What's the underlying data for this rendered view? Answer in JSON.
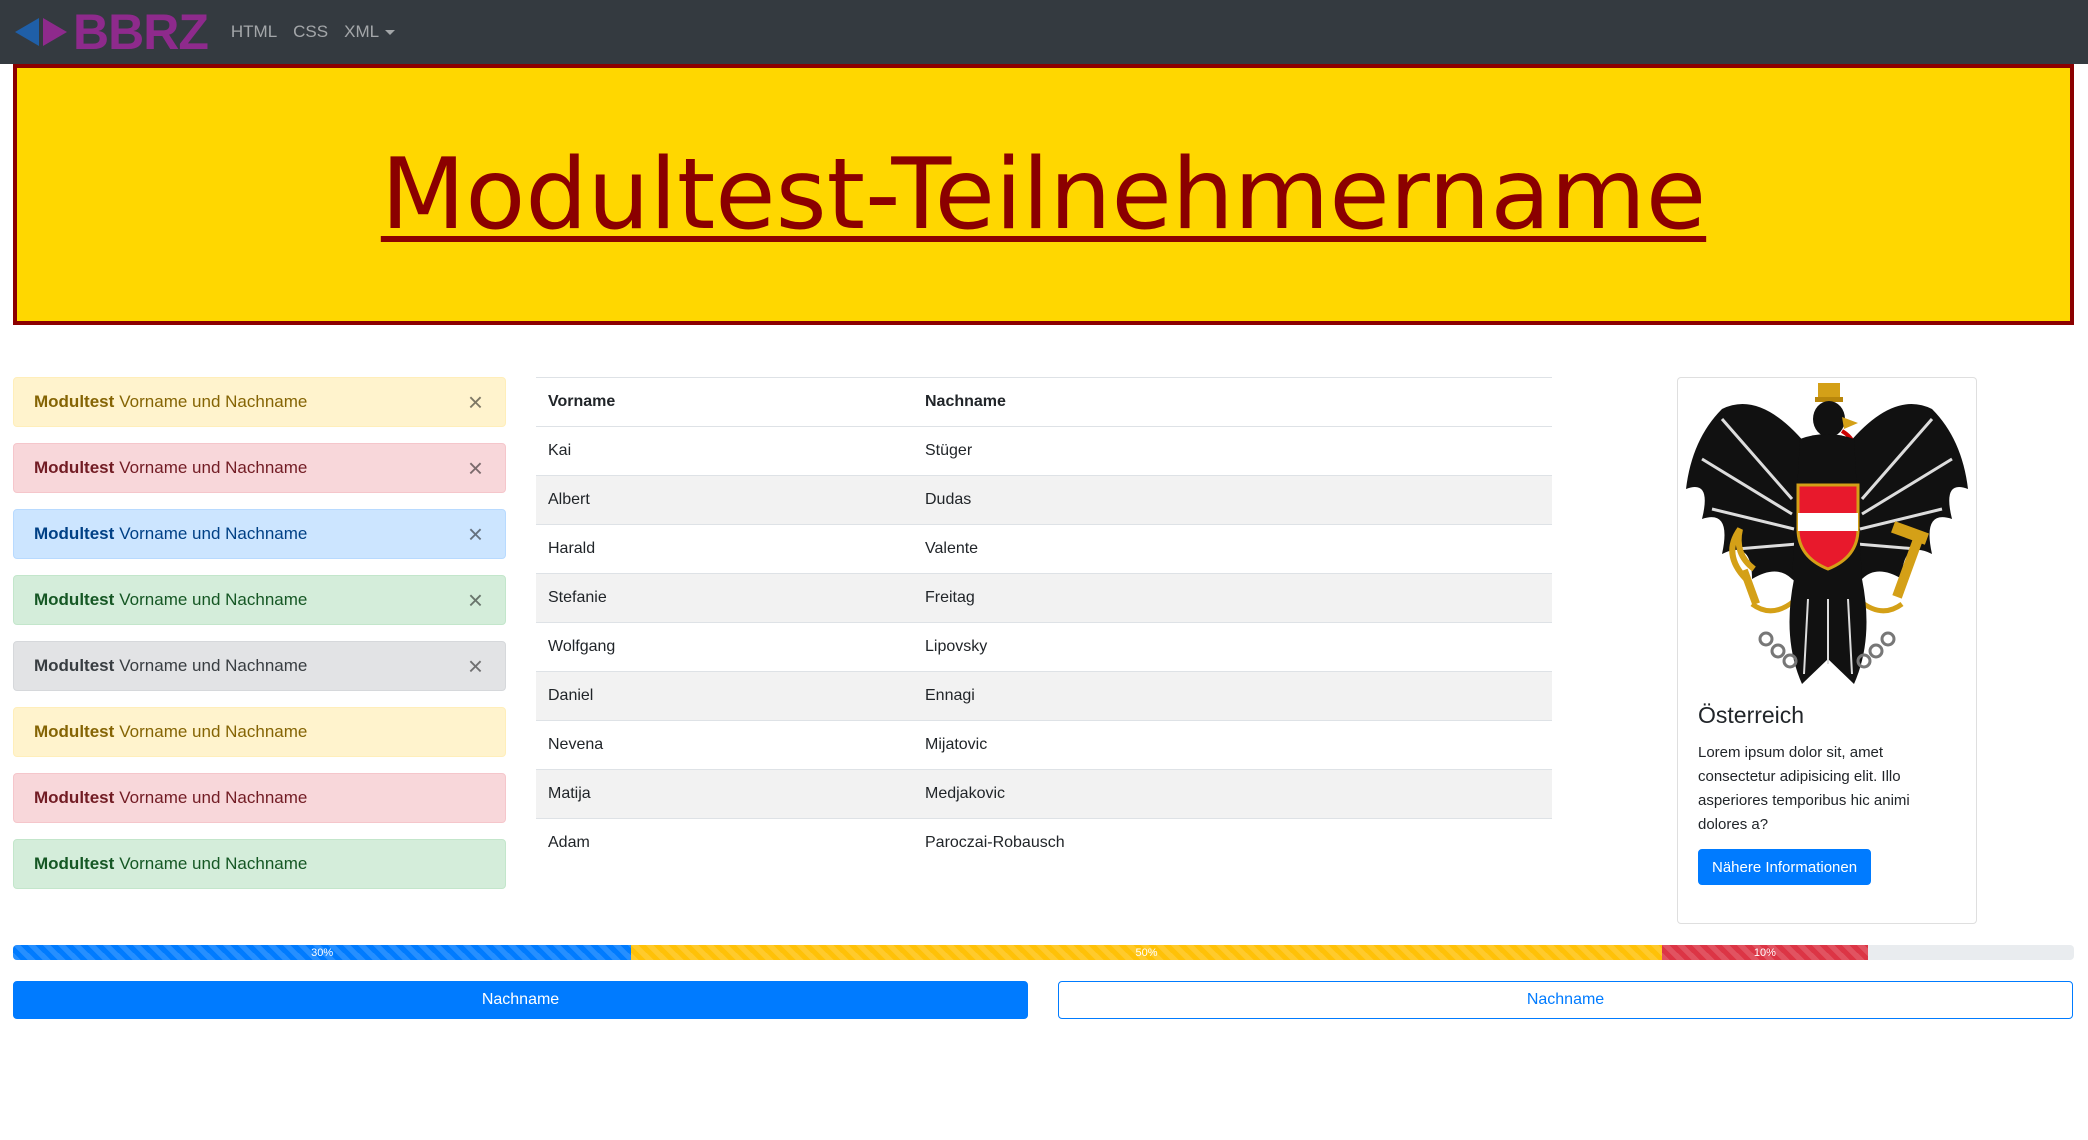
{
  "navbar": {
    "brand": "BBRZ",
    "links": [
      "HTML",
      "CSS",
      "XML"
    ]
  },
  "hero": {
    "title": "Modultest-Teilnehmername"
  },
  "alerts": [
    {
      "bold": "Modultest",
      "text": "Vorname und Nachname",
      "variant": "warning",
      "dismissible": true
    },
    {
      "bold": "Modultest",
      "text": "Vorname und Nachname",
      "variant": "danger",
      "dismissible": true
    },
    {
      "bold": "Modultest",
      "text": "Vorname und Nachname",
      "variant": "primary",
      "dismissible": true
    },
    {
      "bold": "Modultest",
      "text": "Vorname und Nachname",
      "variant": "success",
      "dismissible": true
    },
    {
      "bold": "Modultest",
      "text": "Vorname und Nachname",
      "variant": "secondary",
      "dismissible": true
    },
    {
      "bold": "Modultest",
      "text": "Vorname und Nachname",
      "variant": "warning",
      "dismissible": false
    },
    {
      "bold": "Modultest",
      "text": "Vorname und Nachname",
      "variant": "danger",
      "dismissible": false
    },
    {
      "bold": "Modultest",
      "text": "Vorname und Nachname",
      "variant": "success",
      "dismissible": false
    }
  ],
  "close_glyph": "×",
  "table": {
    "headers": [
      "Vorname",
      "Nachname"
    ],
    "rows": [
      [
        "Kai",
        "Stüger"
      ],
      [
        "Albert",
        "Dudas"
      ],
      [
        "Harald",
        "Valente"
      ],
      [
        "Stefanie",
        "Freitag"
      ],
      [
        "Wolfgang",
        "Lipovsky"
      ],
      [
        "Daniel",
        "Ennagi"
      ],
      [
        "Nevena",
        "Mijatovic"
      ],
      [
        "Matija",
        "Medjakovic"
      ],
      [
        "Adam",
        "Paroczai-Robausch"
      ]
    ]
  },
  "card": {
    "image_icon": "austrian-coat-of-arms",
    "title": "Österreich",
    "text": "Lorem ipsum dolor sit, amet consectetur adipisicing elit. Illo asperiores temporibus hic animi dolores a?",
    "button": "Nähere Informationen"
  },
  "progress": [
    {
      "label": "30%",
      "value": 30,
      "variant": "primary"
    },
    {
      "label": "50%",
      "value": 50,
      "variant": "warning"
    },
    {
      "label": "10%",
      "value": 10,
      "variant": "danger"
    }
  ],
  "buttons": {
    "primary_label": "Nachname",
    "outline_label": "Nachname"
  },
  "colors": {
    "hero_bg": "#ffd700",
    "hero_text": "#8b0000",
    "brand": "#8e2a8c",
    "primary": "#007bff"
  }
}
